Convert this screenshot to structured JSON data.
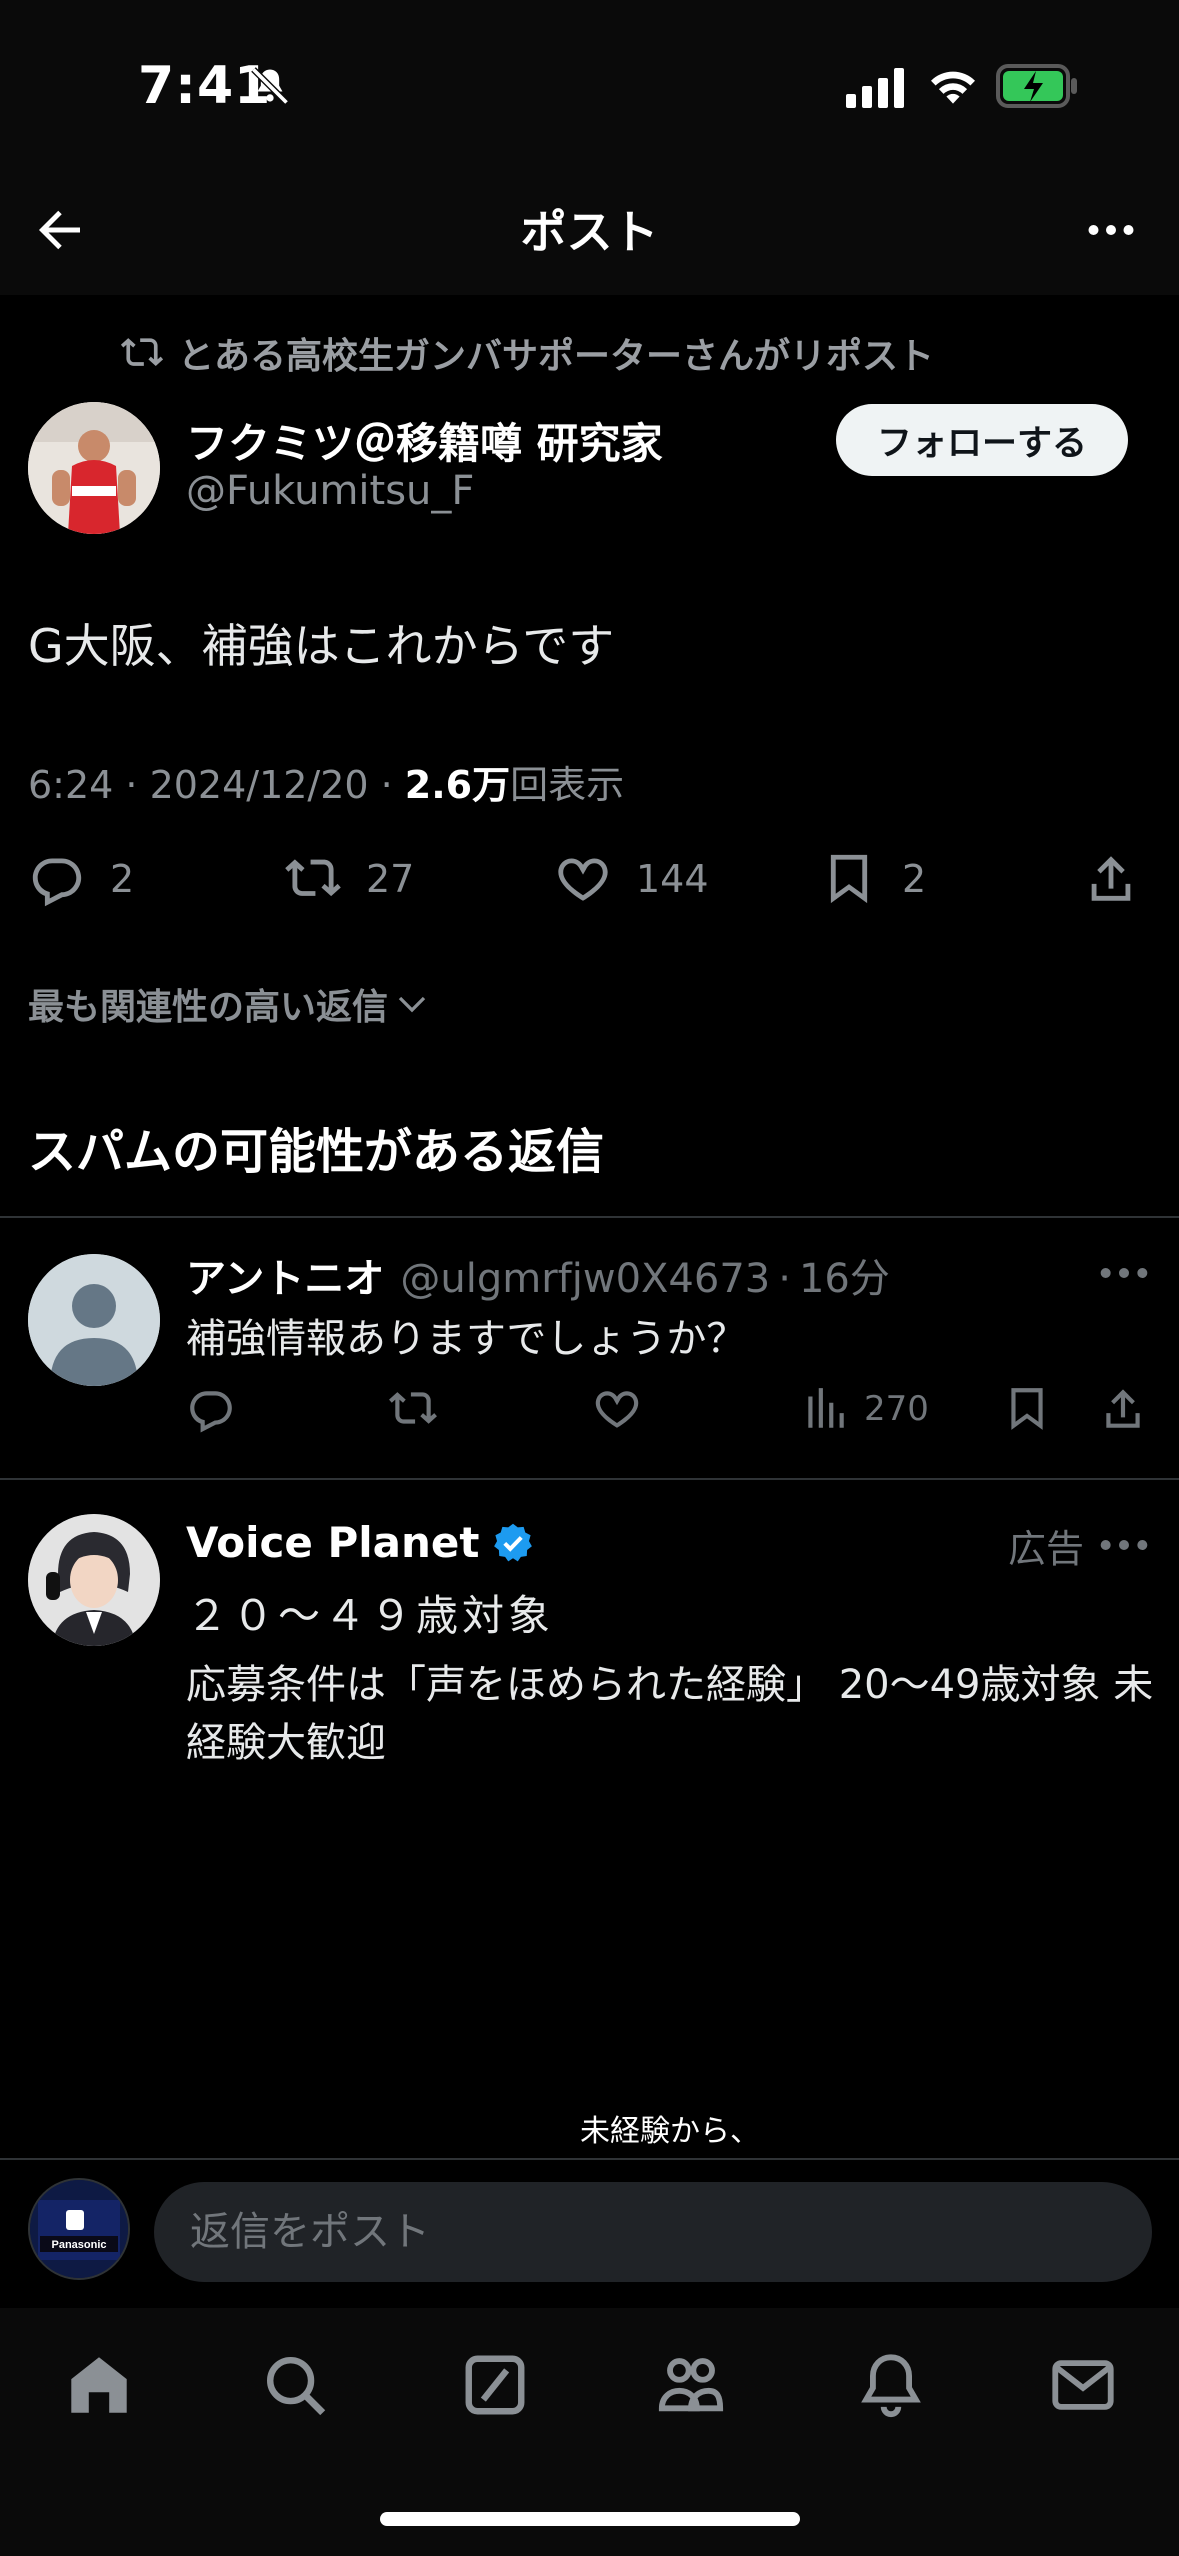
{
  "status_bar": {
    "time": "7:41"
  },
  "header": {
    "title": "ポスト"
  },
  "post": {
    "repost_by": "とある高校生ガンバサポーターさんがリポスト",
    "author_name": "フクミツ＠移籍噂 研究家",
    "author_handle": "@Fukumitsu_F",
    "follow_label": "フォローする",
    "text": "G大阪、補強はこれからです",
    "timestamp": "6:24 · 2024/12/20 ·",
    "views": "2.6万",
    "views_suffix": "回表示",
    "replies": "2",
    "reposts": "27",
    "likes": "144",
    "bookmarks": "2"
  },
  "sort": {
    "label": "最も関連性の高い返信"
  },
  "spam_section": {
    "title": "スパムの可能性がある返信"
  },
  "reply": {
    "name": "アントニオ",
    "handle": "@ulgmrfjw0X4673",
    "separator": "·",
    "time": "16分",
    "text": "補強情報ありますでしょうか？",
    "views": "270"
  },
  "ad": {
    "name": "Voice Planet",
    "ad_label": "広告",
    "subtitle": "２０～４９歳対象",
    "body": "応募条件は「声をほめられた経験」 20〜49歳対象 未経験大歓迎",
    "media_caption": "未経験から、"
  },
  "composer": {
    "placeholder": "返信をポスト"
  },
  "colors": {
    "background": "#000000",
    "accent": "#1d9bf0",
    "muted": "#71767b",
    "battery": "#34c759"
  }
}
